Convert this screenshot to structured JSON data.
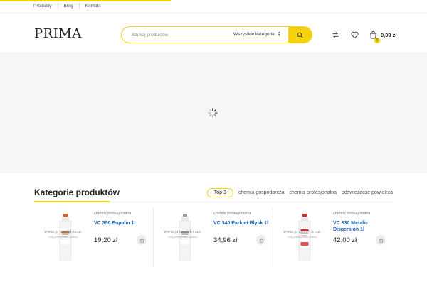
{
  "topnav": {
    "items": [
      "Produkty",
      "Blog",
      "Kontakt"
    ]
  },
  "header": {
    "logo": "PRIMA",
    "search_placeholder": "Szukaj produktów",
    "category_select": "Wszystkie kategorie",
    "cart_count": "0",
    "cart_total": "0,00 zł"
  },
  "section": {
    "title": "Kategorie produktów",
    "tabs": [
      "Top 3",
      "chemia gospodarcza",
      "chemia profesjonalna",
      "odświeżacze powietrza"
    ]
  },
  "products": [
    {
      "category": "chemia profesjonalna",
      "name": "VC 350 Eupalin 1l",
      "price": "19,20 zł"
    },
    {
      "category": "chemia profesjonalna",
      "name": "VC 340 Parkiet Błysk 1l",
      "price": "34,96 zł"
    },
    {
      "category": "chemia profesjonalna",
      "name": "VC 330 Metalic Dispersion 1l",
      "price": "42,00 zł"
    }
  ],
  "watermark": {
    "site": "www.prima24.com",
    "tagline": "Twoj profesjonalny partner"
  },
  "colors": {
    "accent": "#f5d20c",
    "link": "#1a62b4",
    "banner_bg": "#f6f6f6"
  },
  "icons": [
    "search-icon",
    "compare-icon",
    "heart-icon",
    "bag-icon",
    "loading-spinner",
    "add-to-cart-icon"
  ]
}
